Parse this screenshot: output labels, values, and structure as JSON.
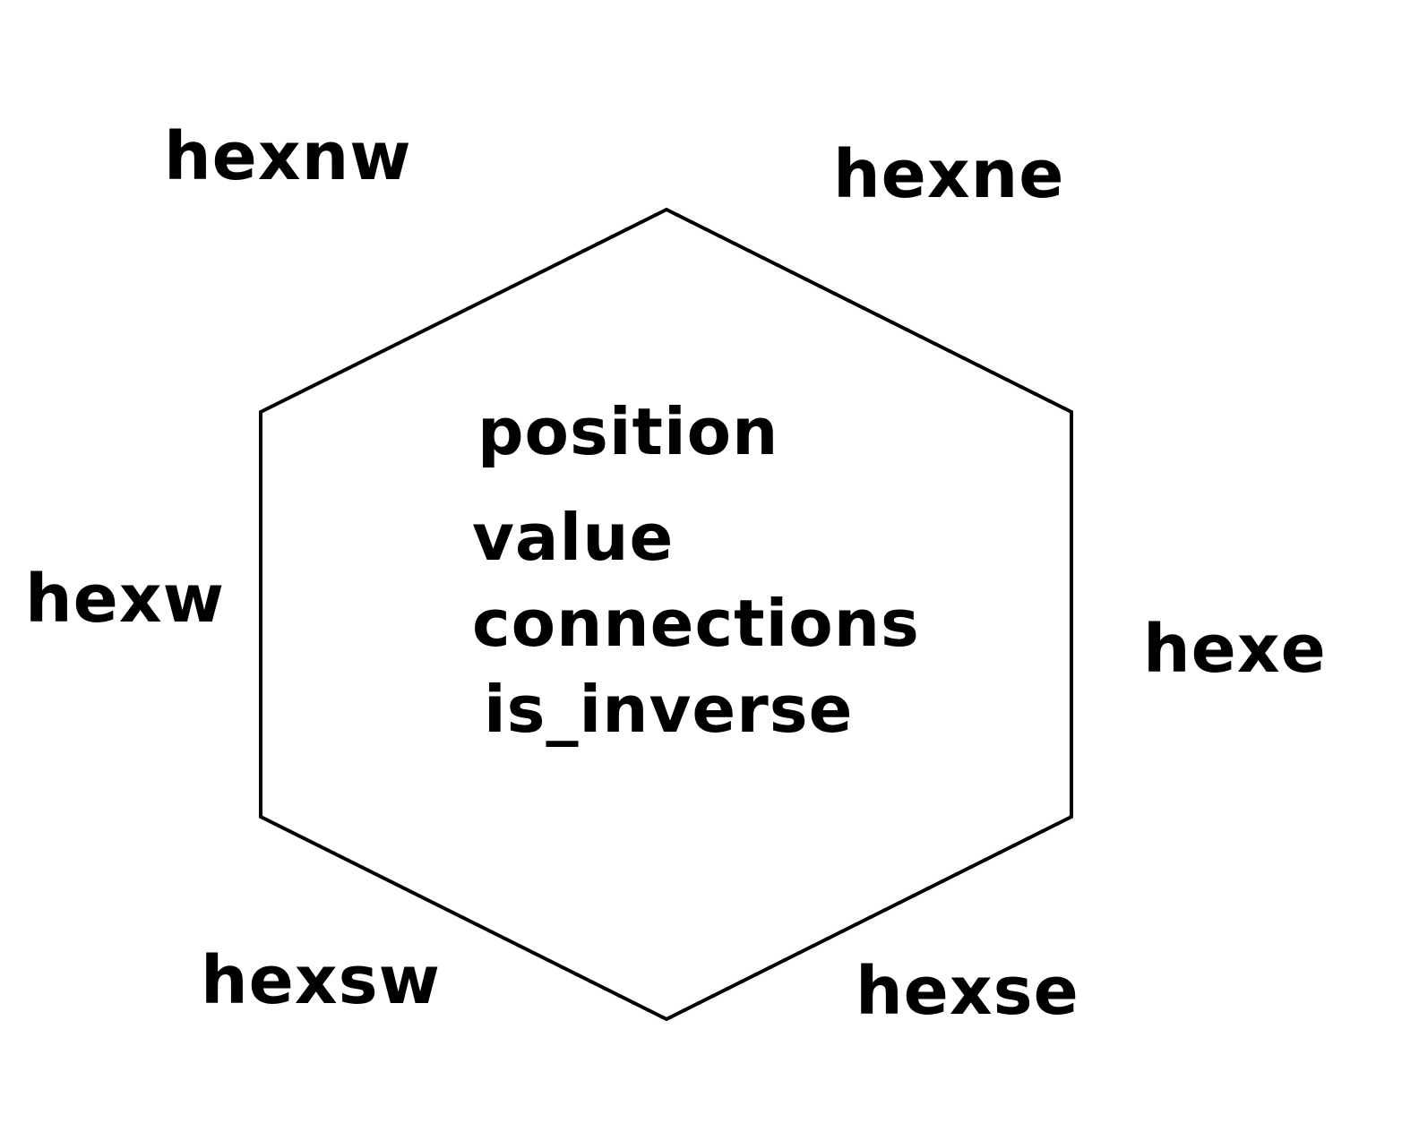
{
  "diagram": {
    "neighbors": {
      "nw": "hexnw",
      "ne": "hexne",
      "w": "hexw",
      "e": "hexe",
      "sw": "hexsw",
      "se": "hexse"
    },
    "fields": [
      "position",
      "value",
      "connections",
      "is_inverse"
    ],
    "colors": {
      "stroke": "#000000",
      "text": "#000000",
      "background": "#ffffff"
    }
  }
}
